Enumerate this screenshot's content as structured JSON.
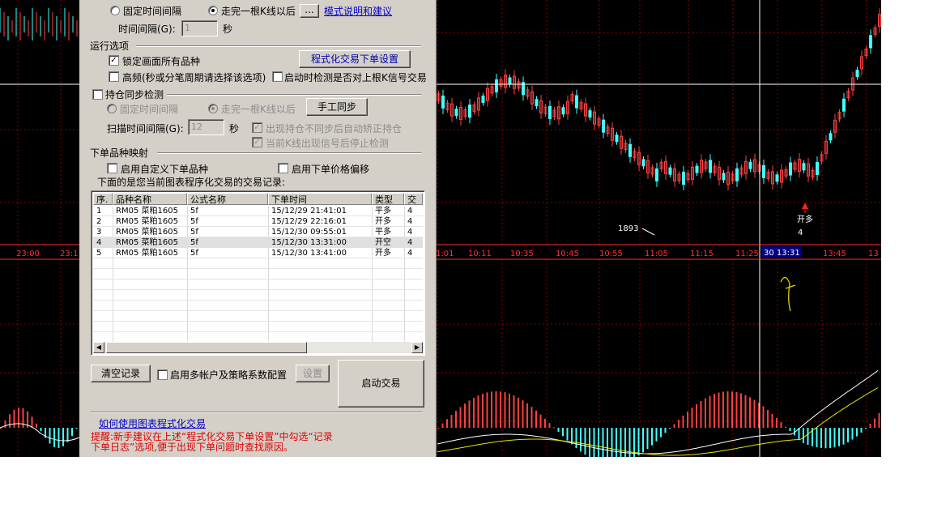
{
  "dialog": {
    "section_mode": {
      "radio_fixed_label": "固定时间间隔",
      "radio_after_bar_label": "走完一根K线以后",
      "dots_label": "...",
      "link_mode_help": "模式说明和建议",
      "interval_label": "时间间隔(G):",
      "interval_value": "1",
      "interval_unit": "秒"
    },
    "section_run": {
      "title": "运行选项",
      "lock_all_label": "锁定画面所有品种",
      "lock_all_checked": true,
      "order_settings_button": "程式化交易下单设置",
      "high_freq_label": "高频(秒或分笔周期请选择该选项)",
      "high_freq_checked": false,
      "check_signal_label": "启动时检测是否对上根K信号交易",
      "check_signal_checked": false
    },
    "section_position": {
      "title": "持仓同步检测",
      "checked": false,
      "radio_fixed_label": "固定时间间隔",
      "radio_after_bar_label": "走完一根K线以后",
      "manual_sync_button": "手工同步",
      "scan_interval_label": "扫描时间间隔(G):",
      "scan_interval_value": "12",
      "scan_interval_unit": "秒",
      "auto_correct_label": "出现持仓不同步后自动矫正持仓",
      "auto_correct_checked": true,
      "stop_check_label": "当前K线出现信号后停止检测",
      "stop_check_checked": true
    },
    "section_mapping": {
      "title": "下单品种映射",
      "custom_symbol_label": "启用自定义下单品种",
      "custom_symbol_checked": false,
      "price_offset_label": "启用下单价格偏移",
      "price_offset_checked": false
    },
    "records_caption": "下面的是您当前图表程序化交易的交易记录:",
    "columns": [
      "序.",
      "品种名称",
      "公式名称",
      "下单时间",
      "类型",
      "交易"
    ],
    "records": [
      {
        "idx": "1",
        "symbol": "RM05 菜粕1605",
        "formula": "5f",
        "time": "15/12/29 21:41:01",
        "type": "平多",
        "qty": "4"
      },
      {
        "idx": "2",
        "symbol": "RM05 菜粕1605",
        "formula": "5f",
        "time": "15/12/29 22:16:01",
        "type": "开多",
        "qty": "4"
      },
      {
        "idx": "3",
        "symbol": "RM05 菜粕1605",
        "formula": "5f",
        "time": "15/12/30 09:55:01",
        "type": "平多",
        "qty": "4"
      },
      {
        "idx": "4",
        "symbol": "RM05 菜粕1605",
        "formula": "5f",
        "time": "15/12/30 13:31:00",
        "type": "开空",
        "qty": "4"
      },
      {
        "idx": "5",
        "symbol": "RM05 菜粕1605",
        "formula": "5f",
        "time": "15/12/30 13:41:00",
        "type": "开多",
        "qty": "4"
      }
    ],
    "clear_button": "清空记录",
    "multi_account_label": "启用多帐户及策略系数配置",
    "multi_account_checked": false,
    "settings_button": "设置",
    "start_button": "启动交易",
    "help_link": "如何使用图表程式化交易",
    "warning_line1": "提醒:新手建议在上述“程式化交易下单设置”中勾选“记录",
    "warning_line2": "下单日志”选项,便于出现下单问题时查找原因。"
  },
  "chart": {
    "time_labels": [
      "23:00",
      "23:1",
      "1:01",
      "10:11",
      "10:35",
      "10:45",
      "10:55",
      "11:05",
      "11:15",
      "11:25",
      "13:45",
      "13"
    ],
    "cursor_time": "30 13:31",
    "low_label": "1893",
    "signal_label": "开多",
    "signal_qty": "4",
    "colors": {
      "background": "#000000",
      "up": "#ff4040",
      "down": "#40ffff",
      "axis": "#ff3030",
      "grid": "#8b0000"
    }
  }
}
